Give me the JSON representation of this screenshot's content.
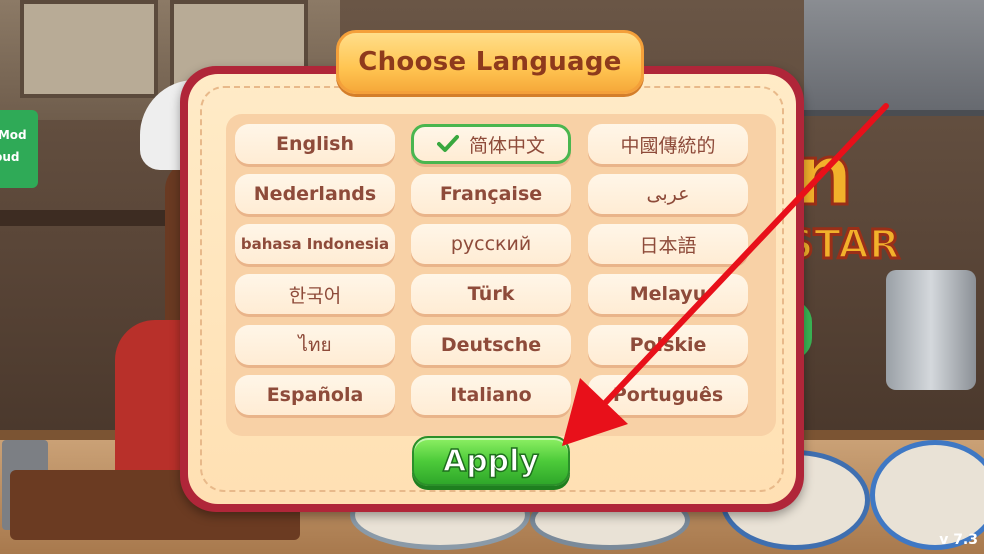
{
  "side_tag": {
    "line1": "yMod",
    "line2": "loud"
  },
  "logo": {
    "line1": "in",
    "line2": "STAR"
  },
  "version": "v 7.3",
  "dialog": {
    "title": "Choose Language",
    "languages": [
      {
        "label": "English"
      },
      {
        "label": "简体中文",
        "selected": true
      },
      {
        "label": "中國傳統的"
      },
      {
        "label": "Nederlands"
      },
      {
        "label": "Française"
      },
      {
        "label": "عربى"
      },
      {
        "label": "bahasa Indonesia"
      },
      {
        "label": "русский"
      },
      {
        "label": "日本語"
      },
      {
        "label": "한국어"
      },
      {
        "label": "Türk"
      },
      {
        "label": "Melayu"
      },
      {
        "label": "ไทย"
      },
      {
        "label": "Deutsche"
      },
      {
        "label": "Polskie"
      },
      {
        "label": "Española"
      },
      {
        "label": "Italiano"
      },
      {
        "label": "Português"
      }
    ],
    "apply_label": "Apply"
  },
  "colors": {
    "dialog_border": "#b02639",
    "panel": "#f8d1a6",
    "selected_border": "#4ab64f",
    "apply_green": "#4dcb3a",
    "arrow": "#e8101a"
  }
}
